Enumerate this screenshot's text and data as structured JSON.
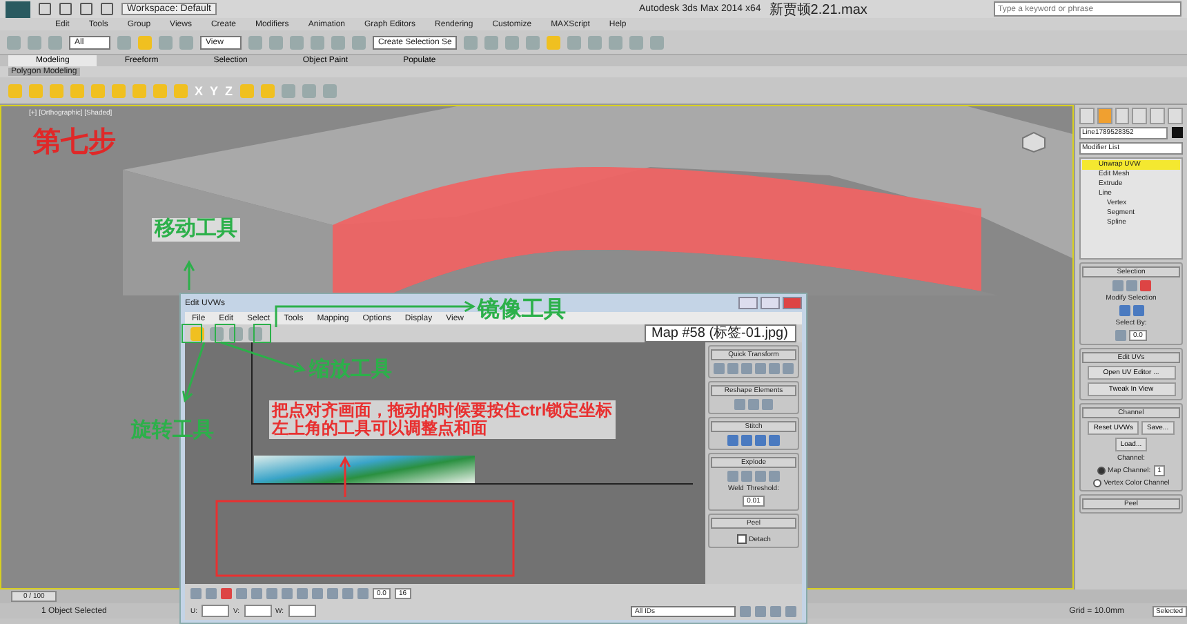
{
  "title_bar": {
    "workspace": "Workspace: Default",
    "title": "Autodesk 3ds Max 2014 x64",
    "file": "新贾顿2.21.max",
    "search": {
      "placeholder": "Type a keyword or phrase"
    }
  },
  "menu": [
    "Edit",
    "Tools",
    "Group",
    "Views",
    "Create",
    "Modifiers",
    "Animation",
    "Graph Editors",
    "Rendering",
    "Customize",
    "MAXScript",
    "Help"
  ],
  "main_toolbar": {
    "filter": "All",
    "coordinate": "View",
    "selection_set": "Create Selection Se"
  },
  "ribbon": {
    "tabs": [
      {
        "label": "Modeling",
        "selected": true
      },
      {
        "label": "Freeform",
        "selected": false
      },
      {
        "label": "Selection",
        "selected": false
      },
      {
        "label": "Object Paint",
        "selected": false
      },
      {
        "label": "Populate",
        "selected": false
      }
    ],
    "panel": "Polygon Modeling",
    "axes": [
      "X",
      "Y",
      "Z"
    ]
  },
  "viewport": {
    "label": "[+] [Orthographic] [Shaded]"
  },
  "annotations": [
    {
      "kind": "step",
      "text": "第七步"
    },
    {
      "kind": "tool",
      "text": "移动工具"
    },
    {
      "kind": "tool",
      "text": "镜像工具"
    },
    {
      "kind": "tool",
      "text": "缩放工具"
    },
    {
      "kind": "tool",
      "text": "旋转工具"
    },
    {
      "kind": "note",
      "lines": [
        "把点对齐画面，拖动的时候要按住ctrl锁定坐标",
        "左上角的工具可以调整点和面"
      ]
    }
  ],
  "uvw_editor": {
    "title": "Edit UVWs",
    "menu": [
      "File",
      "Edit",
      "Select",
      "Tools",
      "Mapping",
      "Options",
      "Display",
      "View"
    ],
    "map": "Map #58 (标签-01.jpg)",
    "rollouts": [
      {
        "kind": "quick",
        "title": "Quick Transform"
      },
      {
        "kind": "reshape",
        "title": "Reshape Elements"
      },
      {
        "kind": "stitch",
        "title": "Stitch"
      },
      {
        "kind": "explode",
        "title": "Explode",
        "weld": "Weld",
        "threshold_label": "Threshold:",
        "threshold": "0.01"
      },
      {
        "kind": "peel",
        "title": "Peel",
        "detach": "Detach",
        "checked": false
      }
    ],
    "soft": "0.0",
    "brush": "16",
    "coords": [
      "U:",
      "V:",
      "W:"
    ],
    "ids": "All IDs"
  },
  "command_panel": {
    "object_name": "Line1789528352",
    "modifier_list": "Modifier List",
    "stack": [
      {
        "label": "Unwrap UVW",
        "selected": true
      },
      {
        "label": "Edit Mesh",
        "selected": false
      },
      {
        "label": "Extrude",
        "selected": false
      },
      {
        "label": "Line",
        "selected": false,
        "children": [
          {
            "label": "Vertex",
            "selected": false
          },
          {
            "label": "Segment",
            "selected": false
          },
          {
            "label": "Spline",
            "selected": false
          }
        ]
      }
    ],
    "selection": {
      "title": "Selection",
      "modify": "Modify Selection",
      "select_by": "Select By:",
      "angle": "0.0"
    },
    "edit_uvs": {
      "title": "Edit UVs",
      "buttons": [
        "Open UV Editor ...",
        "Tweak In View"
      ]
    },
    "channel": {
      "title": "Channel",
      "reset": "Reset UVWs",
      "save": "Save...",
      "load": "Load...",
      "group": "Channel:",
      "options": [
        {
          "label": "Map Channel:",
          "selected": true
        },
        {
          "label": "Vertex Color Channel",
          "selected": false
        }
      ],
      "map_channel": "1"
    },
    "peel": {
      "title": "Peel"
    }
  },
  "timeline": {
    "frame": "0 / 100",
    "level": 0
  },
  "status_bar": {
    "selection": "1 Object Selected",
    "grid": "Grid = 10.0mm",
    "key": "Selected"
  }
}
